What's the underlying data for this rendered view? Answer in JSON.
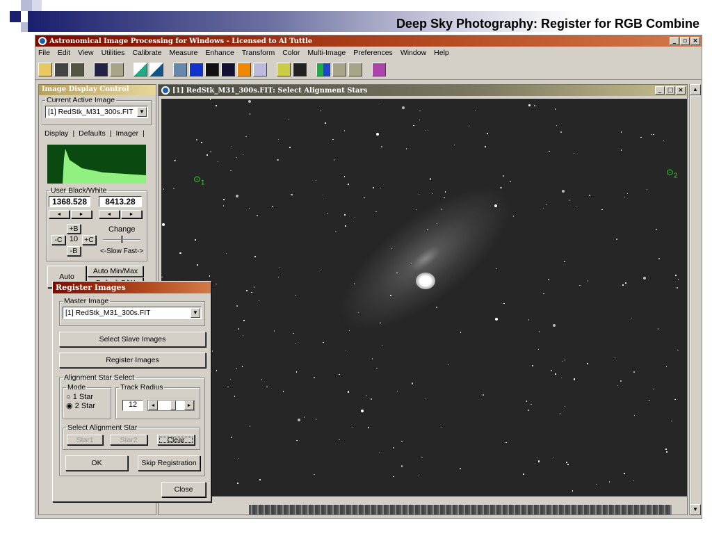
{
  "slide": {
    "title": "Deep Sky Photography: Register for RGB Combine"
  },
  "app": {
    "title": "Astronomical Image Processing for Windows - Licensed to Al Tuttle",
    "menu": [
      "File",
      "Edit",
      "View",
      "Utilities",
      "Calibrate",
      "Measure",
      "Enhance",
      "Transform",
      "Color",
      "Multi-Image",
      "Preferences",
      "Window",
      "Help"
    ]
  },
  "left_panel": {
    "title": "Image Display Control",
    "current_label": "Current Active Image",
    "current_value": "[1] RedStk_M31_300s.FIT",
    "tabs": [
      "Display",
      "Defaults",
      "Imager"
    ],
    "bw_label": "User Black/White",
    "black": "1368.528",
    "white": "8413.28",
    "plus_b": "+B",
    "minus_b": "-B",
    "minus_c": "-C",
    "plus_c": "+C",
    "step": "10",
    "change_label": "Change",
    "slow_fast": "<-Slow Fast->",
    "auto": "Auto",
    "auto_minmax": "Auto Min/Max",
    "default_bw": "Default B/W"
  },
  "image_window": {
    "title": "[1] RedStk_M31_300s.FIT: Select Alignment Stars",
    "star_markers": [
      "1",
      "2"
    ]
  },
  "dialog": {
    "title": "Register Images",
    "master_label": "Master Image",
    "master_value": "[1] RedStk_M31_300s.FIT",
    "select_slave": "Select Slave Images",
    "register": "Register Images",
    "align_label": "Alignment Star Select",
    "mode_label": "Mode",
    "mode_options": [
      "1 Star",
      "2 Star"
    ],
    "mode_selected": "2 Star",
    "track_label": "Track Radius",
    "track_value": "12",
    "select_star_label": "Select Alignment Star",
    "star1": "Star1",
    "star2": "Star2",
    "clear": "Clear",
    "ok": "OK",
    "skip": "Skip Registration",
    "close": "Close"
  }
}
